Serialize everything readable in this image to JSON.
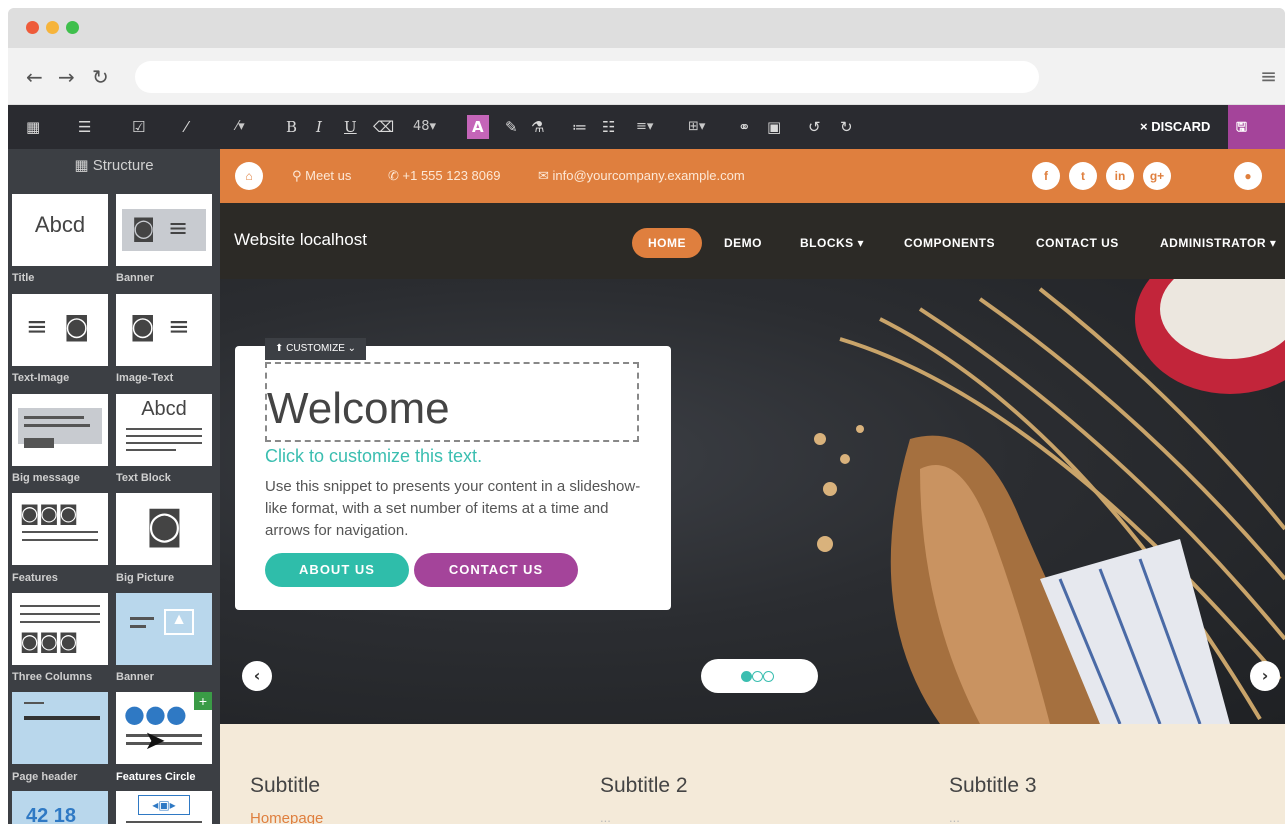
{
  "window": {
    "dot_colors": [
      "#ee5b3a",
      "#f6b43b",
      "#3fbf4c"
    ],
    "back_icon": "arrow-left-icon",
    "forward_icon": "arrow-right-icon",
    "reload_icon": "reload-icon",
    "menu_icon": "hamburger-icon"
  },
  "toolbar": {
    "font_size": "48",
    "discard_label": "× DISCARD",
    "save_label": "🖫 SAVE",
    "save_color": "#a4449a"
  },
  "sidebar": {
    "title": "Structure",
    "snippets": [
      {
        "label": "Title",
        "preview_text": "Abcd"
      },
      {
        "label": "Banner"
      },
      {
        "label": "Text-Image"
      },
      {
        "label": "Image-Text"
      },
      {
        "label": "Big message"
      },
      {
        "label": "Text Block",
        "preview_text": "Abcd"
      },
      {
        "label": "Features"
      },
      {
        "label": "Big Picture"
      },
      {
        "label": "Three Columns"
      },
      {
        "label": "Banner"
      },
      {
        "label": "Page header"
      },
      {
        "label": "Features Circle"
      },
      {
        "preview_text": "42  18"
      }
    ]
  },
  "site": {
    "topbar": {
      "meet": "⚲ Meet us",
      "phone": "✆ +1 555 123 8069",
      "email": "✉ info@yourcompany.example.com",
      "social": [
        "f",
        "t",
        "in",
        "g+"
      ],
      "color": "#df7f3e"
    },
    "brand": "Website localhost",
    "nav": [
      "HOME",
      "DEMO",
      "BLOCKS ▾",
      "COMPONENTS",
      "CONTACT US",
      "ADMINISTRATOR ▾"
    ],
    "hero": {
      "customize_label": "⬆ CUSTOMIZE ⌄",
      "title": "Welcome",
      "click_text": "Click to customize this text.",
      "paragraph": "Use this snippet to presents your content in a slideshow-like format, with a set number of items at a time and arrows for navigation.",
      "btn_about": "ABOUT US",
      "btn_contact": "CONTACT US",
      "btn_about_color": "#2fbdaa",
      "btn_contact_color": "#a4449a",
      "prev_icon": "chevron-left-icon",
      "next_icon": "chevron-right-icon"
    },
    "lower": {
      "subtitles": [
        "Subtitle",
        "Subtitle 2",
        "Subtitle 3"
      ],
      "link": "Homepage",
      "dots": "...",
      "dots_2": "..."
    }
  }
}
